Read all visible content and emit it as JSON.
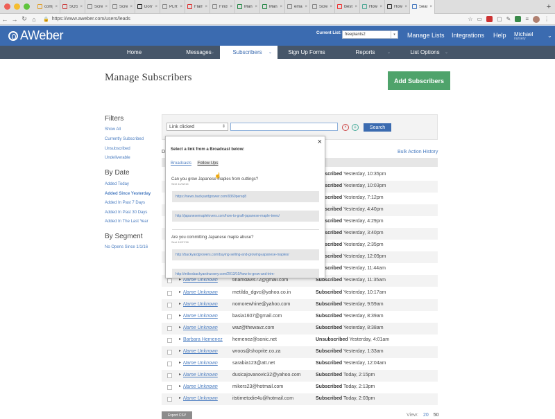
{
  "browser": {
    "tabs": [
      {
        "label": "comp"
      },
      {
        "label": "SOS -"
      },
      {
        "label": "Scree"
      },
      {
        "label": "Scree"
      },
      {
        "label": "Don't"
      },
      {
        "label": "PLR A"
      },
      {
        "label": "Flami"
      },
      {
        "label": "Find C"
      },
      {
        "label": "Mana"
      },
      {
        "label": "Mana"
      },
      {
        "label": "email"
      },
      {
        "label": "Scree"
      },
      {
        "label": "Best"
      },
      {
        "label": "How"
      },
      {
        "label": "How"
      },
      {
        "label": "Searc"
      }
    ],
    "new_tab": "+",
    "url": "https://www.aweber.com/users/leads"
  },
  "header": {
    "logo_text": "AWeber",
    "current_list_label": "Current List:",
    "current_list_value": "freeplants2",
    "nav": [
      "Manage Lists",
      "Integrations",
      "Help"
    ],
    "user_name": "Michael",
    "user_sub": "nursery"
  },
  "main_nav": {
    "items": [
      "Home",
      "Messages",
      "Subscribers",
      "Sign Up Forms",
      "Reports",
      "List Options"
    ]
  },
  "page": {
    "title": "Manage Subscribers",
    "add_button": "Add Subscribers"
  },
  "sidebar": {
    "filters_heading": "Filters",
    "filters": [
      "Show All",
      "Currently Subscribed",
      "Unsubscribed",
      "Undeliverable"
    ],
    "by_date_heading": "By Date",
    "by_date": [
      "Added Today",
      "Added Since Yesterday",
      "Added In Past 7 Days",
      "Added In Past 30 Days",
      "Added In The Last Year"
    ],
    "by_segment_heading": "By Segment",
    "segments": [
      "No Opens Since 1/1/16"
    ]
  },
  "filter": {
    "select_value": "Link clicked",
    "input_value": "",
    "remove_icon": "×",
    "add_icon": "+",
    "search_button": "Search"
  },
  "table": {
    "partial_label": "D",
    "bulk_history": "Bulk Action History",
    "hidden_rows": [
      {
        "status": "Subscribed",
        "time": "Yesterday, 10:35pm"
      },
      {
        "status": "Subscribed",
        "time": "Yesterday, 10:03pm"
      },
      {
        "status": "Subscribed",
        "time": "Yesterday, 7:12pm"
      },
      {
        "status": "Subscribed",
        "time": "Yesterday, 4:40pm"
      },
      {
        "status": "Subscribed",
        "time": "Yesterday, 4:29pm"
      },
      {
        "status": "Subscribed",
        "time": "Yesterday, 3:40pm"
      },
      {
        "status": "Subscribed",
        "time": "Yesterday, 2:35pm"
      },
      {
        "status": "Subscribed",
        "time": "Yesterday, 12:09pm"
      },
      {
        "status": "Subscribed",
        "time": "Yesterday, 11:44am"
      }
    ],
    "rows": [
      {
        "name": "Name Unknown",
        "email": "tinamdavis72@gmail.com",
        "status": "Subscribed",
        "time": "Yesterday, 11:35am"
      },
      {
        "name": "Name Unknown",
        "email": "metilda_dgvc@yahoo.co.in",
        "status": "Subscribed",
        "time": "Yesterday, 10:17am"
      },
      {
        "name": "Name Unknown",
        "email": "nomorewhine@yahoo.com",
        "status": "Subscribed",
        "time": "Yesterday, 9:59am"
      },
      {
        "name": "Name Unknown",
        "email": "basia1607@gmail.com",
        "status": "Subscribed",
        "time": "Yesterday, 8:39am"
      },
      {
        "name": "Name Unknown",
        "email": "waz@thewavz.com",
        "status": "Subscribed",
        "time": "Yesterday, 8:38am"
      },
      {
        "name": "Barbara Hemenez",
        "email": "hemenez@sonic.net",
        "status": "Unsubscribed",
        "time": "Yesterday, 4:01am"
      },
      {
        "name": "Name Unknown",
        "email": "wroos@shoprite.co.za",
        "status": "Subscribed",
        "time": "Yesterday, 1:33am"
      },
      {
        "name": "Name Unknown",
        "email": "sarabia123@att.net",
        "status": "Subscribed",
        "time": "Yesterday, 12:04am"
      },
      {
        "name": "Name Unknown",
        "email": "dusicajovanovic32@yahoo.com",
        "status": "Subscribed",
        "time": "Today, 2:15pm"
      },
      {
        "name": "Name Unknown",
        "email": "mikers23@hotmail.com",
        "status": "Subscribed",
        "time": "Today, 2:13pm"
      },
      {
        "name": "Name Unknown",
        "email": "itstimetodie4u@hotmail.com",
        "status": "Subscribed",
        "time": "Today, 2:03pm"
      }
    ]
  },
  "modal": {
    "close": "×",
    "title": "Select a link from a Broadcast below:",
    "tab_broadcasts": "Broadcasts",
    "tab_follow_ups": "Follow Ups",
    "groups": [
      {
        "question": "Can you grow Japanese maples from cuttings?",
        "sent": "Sent 11/02/16",
        "links": [
          "https://news.backyardgrower.com/9360persq8",
          "http://japanesemaplelovers.com/how-to-graft-japanese-maple-trees/"
        ]
      },
      {
        "question": "Are you committing Japanese maple abuse?",
        "sent": "Sent 10/27/16",
        "links": [
          "http://backyardgrowers.com/buying-selling-and-growing-japanese-maples/",
          "http://mikesbackyardnursery.com/2013/10/how-to-grow-and-trim-"
        ]
      }
    ]
  },
  "footer": {
    "export": "Export CSV",
    "view_label": "View:",
    "view_options": [
      "20",
      "50"
    ]
  },
  "colors": {
    "brand_blue": "#3b6bb0",
    "nav_dark": "#465669",
    "add_green": "#4fa36b",
    "link_blue": "#4a7cc0"
  }
}
